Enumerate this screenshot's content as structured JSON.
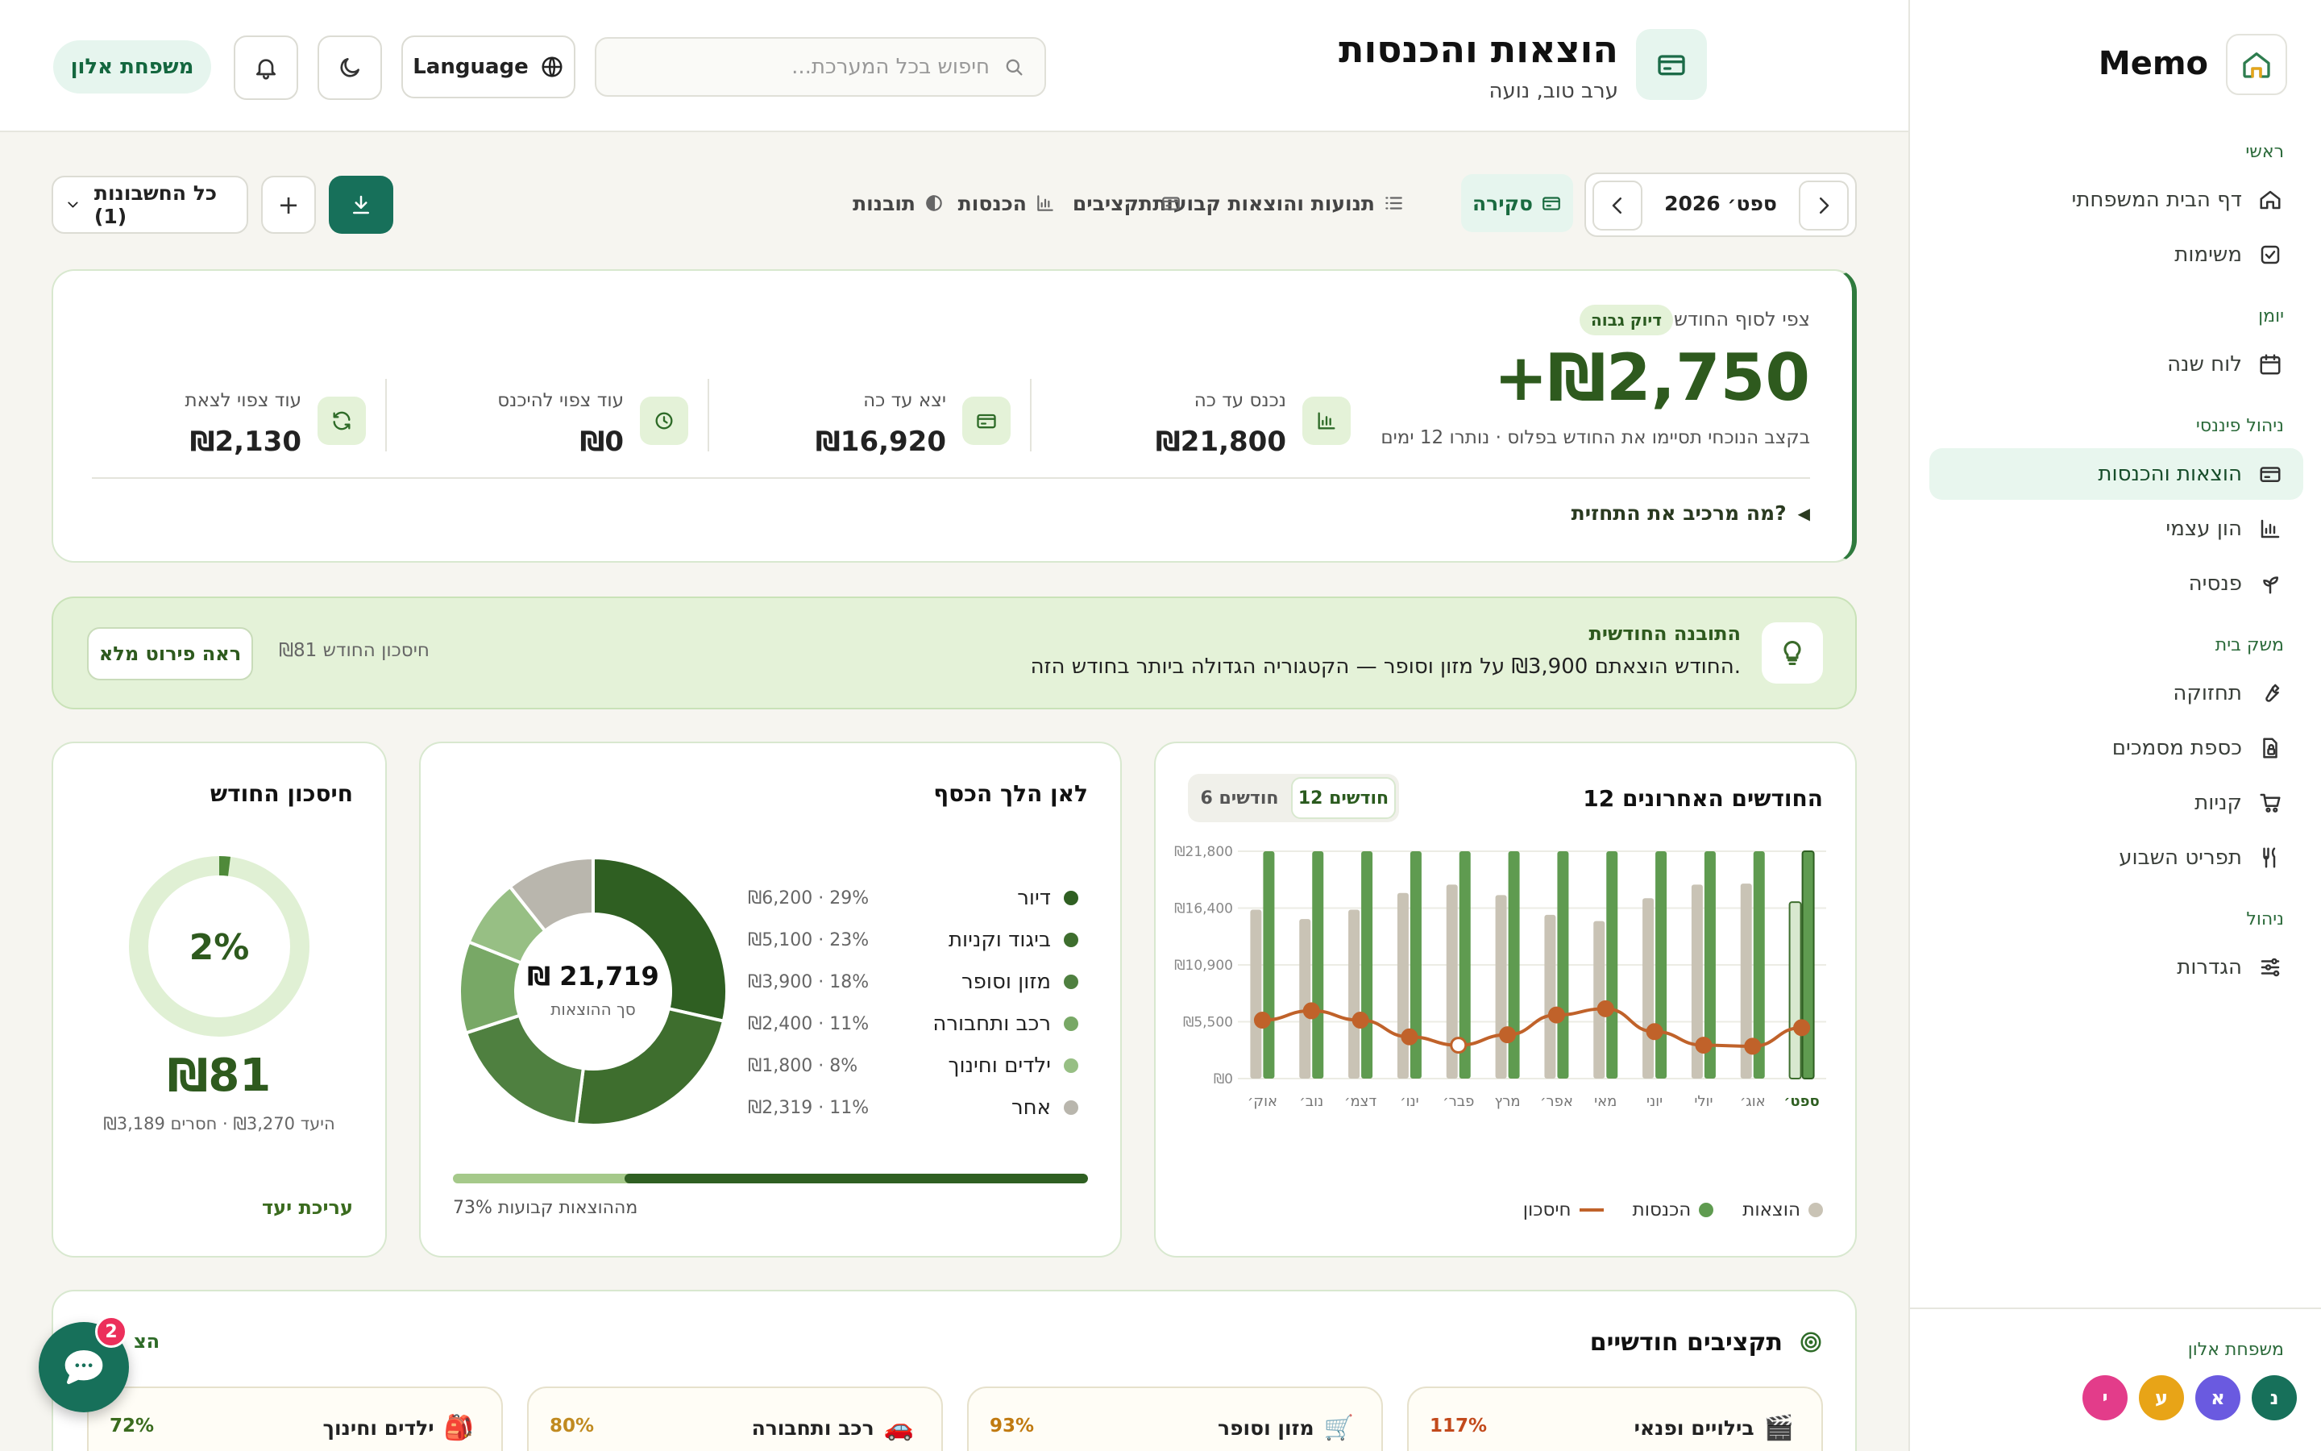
{
  "app": {
    "name": "Memo"
  },
  "sidebar": {
    "sections": [
      {
        "title": "ראשי",
        "items": [
          {
            "label": "דף הבית המשפחתי",
            "icon": "home-icon"
          },
          {
            "label": "משימות",
            "icon": "checkbox-icon"
          }
        ]
      },
      {
        "title": "יומן",
        "items": [
          {
            "label": "לוח שנה",
            "icon": "calendar-icon"
          }
        ]
      },
      {
        "title": "ניהול פיננסי",
        "items": [
          {
            "label": "הוצאות והכנסות",
            "icon": "card-icon",
            "active": true
          },
          {
            "label": "הון עצמי",
            "icon": "bar-chart-icon"
          },
          {
            "label": "פנסיה",
            "icon": "sprout-icon"
          }
        ]
      },
      {
        "title": "משק בית",
        "items": [
          {
            "label": "תחזוקה",
            "icon": "wrench-icon"
          },
          {
            "label": "כספת מסמכים",
            "icon": "lock-file-icon"
          },
          {
            "label": "קניות",
            "icon": "cart-icon"
          },
          {
            "label": "תפריט השבוע",
            "icon": "utensils-icon"
          }
        ]
      },
      {
        "title": "ניהול",
        "items": [
          {
            "label": "הגדרות",
            "icon": "sliders-icon"
          }
        ]
      }
    ],
    "family_label": "משפחת אלון",
    "members": [
      {
        "initial": "נ",
        "color": "#17705a"
      },
      {
        "initial": "א",
        "color": "#6a5ae0"
      },
      {
        "initial": "ע",
        "color": "#e8a417"
      },
      {
        "initial": "י",
        "color": "#e33c8a"
      }
    ]
  },
  "header": {
    "title": "הוצאות והכנסות",
    "greeting": "ערב טוב, נועה",
    "search_placeholder": "חיפוש בכל המערכת...",
    "language_label": "Language",
    "family_badge": "משפחת אלון"
  },
  "toolbar": {
    "month": "ספט׳ 2026",
    "tabs": [
      {
        "label": "סקירה",
        "icon": "card-icon",
        "active": true
      },
      {
        "label": "תנועות והוצאות קבועות",
        "icon": "list-icon"
      },
      {
        "label": "תקציבים",
        "icon": "wallet-icon"
      },
      {
        "label": "הכנסות",
        "icon": "bar-chart-icon"
      },
      {
        "label": "תובנות",
        "icon": "half-circle-icon"
      }
    ],
    "add_label": "+",
    "accounts_label": "כל החשבונות (1)"
  },
  "forecast": {
    "label": "צפי לסוף החודש",
    "badge": "דיוק גבוה",
    "amount": "+₪2,750",
    "note": "בקצב הנוכחי תסיימו את החודש בפלוס · נותרו 12 ימים",
    "stats": [
      {
        "label": "נכנס עד כה",
        "value": "₪21,800",
        "icon": "bar-chart-icon"
      },
      {
        "label": "יצא עד כה",
        "value": "₪16,920",
        "icon": "card-icon"
      },
      {
        "label": "עוד צפוי להיכנס",
        "value": "₪0",
        "icon": "clock-icon"
      },
      {
        "label": "עוד צפוי לצאת",
        "value": "₪2,130",
        "icon": "refresh-icon"
      }
    ],
    "breakdown_link": "מה מרכיב את התחזית?"
  },
  "insight": {
    "title": "התובנה החודשית",
    "text": "החודש הוצאתם ₪3,900 על מזון וסופר — הקטגוריה הגדולה ביותר בחודש הזה.",
    "savings": "חיסכון החודש ₪81",
    "button": "ראה פירוט מלא"
  },
  "trend": {
    "title": "12 החודשים האחרונים",
    "range_options": [
      "12 חודשים",
      "6 חודשים"
    ],
    "legend": [
      "הוצאות",
      "הכנסות",
      "חיסכון"
    ]
  },
  "chart_data": {
    "type": "bar",
    "categories": [
      "אוק׳",
      "נוב׳",
      "דצמ׳",
      "ינו׳",
      "פבר׳",
      "מרץ",
      "אפר׳",
      "מאי",
      "יוני",
      "יולי",
      "אוג׳",
      "ספט׳"
    ],
    "series": [
      {
        "name": "הוצאות",
        "type": "bar",
        "color": "#c9c3b5",
        "values": [
          16200,
          15300,
          16200,
          17800,
          18600,
          17600,
          15700,
          15100,
          17300,
          18600,
          18700,
          16920
        ]
      },
      {
        "name": "הכנסות",
        "type": "bar",
        "color": "#5f9b50",
        "values": [
          21800,
          21800,
          21800,
          21800,
          21800,
          21800,
          21800,
          21800,
          21800,
          21800,
          21800,
          21800
        ]
      },
      {
        "name": "חיסכון",
        "type": "line",
        "color": "#c0622a",
        "values": [
          5600,
          6500,
          5600,
          4000,
          3200,
          4200,
          6100,
          6700,
          4500,
          3200,
          3100,
          4880
        ]
      }
    ],
    "yticks": [
      "₪0",
      "₪5,500",
      "₪10,900",
      "₪16,400",
      "₪21,800"
    ],
    "ylim": [
      0,
      21800
    ]
  },
  "spending": {
    "title": "לאן הלך הכסף",
    "total": "₪ 21,719",
    "total_label": "סך ההוצאות",
    "categories": [
      {
        "name": "דיור",
        "value": "₪6,200 · 29%",
        "color": "#2f5f22",
        "amount": 6200
      },
      {
        "name": "ביגוד וקניות",
        "value": "₪5,100 · 23%",
        "color": "#3e6e2e",
        "amount": 5100
      },
      {
        "name": "מזון וסופר",
        "value": "₪3,900 · 18%",
        "color": "#4f8040",
        "amount": 3900
      },
      {
        "name": "רכב ותחבורה",
        "value": "₪2,400 · 11%",
        "color": "#78a866",
        "amount": 2400
      },
      {
        "name": "ילדים וחינוך",
        "value": "₪1,800 · 8%",
        "color": "#97bf84",
        "amount": 1800
      },
      {
        "name": "אחר",
        "value": "₪2,319 · 11%",
        "color": "#b9b6ad",
        "amount": 2319
      }
    ],
    "fixed_fraction": 0.73,
    "fixed_label": "73% מההוצאות קבועות"
  },
  "savings": {
    "title": "חיסכון החודש",
    "percent_label": "2%",
    "percent": 0.02,
    "amount": "₪81",
    "goal_text": "היעד ₪3,270 · חסרים ₪3,189",
    "edit_label": "עריכת יעד"
  },
  "budgets": {
    "title": "תקציבים חודשיים",
    "more_label": "הצ",
    "items": [
      {
        "name": "בילויים ופנאי",
        "emoji": "🎬",
        "percent": "117%",
        "color": "#c24a1c"
      },
      {
        "name": "מזון וסופר",
        "emoji": "🛒",
        "percent": "93%",
        "color": "#c07a10"
      },
      {
        "name": "רכב ותחבורה",
        "emoji": "🚗",
        "percent": "80%",
        "color": "#c08a20"
      },
      {
        "name": "ילדים וחינוך",
        "emoji": "🎒",
        "percent": "72%",
        "color": "#3a6b1e"
      }
    ]
  },
  "chat": {
    "badge": "2"
  }
}
